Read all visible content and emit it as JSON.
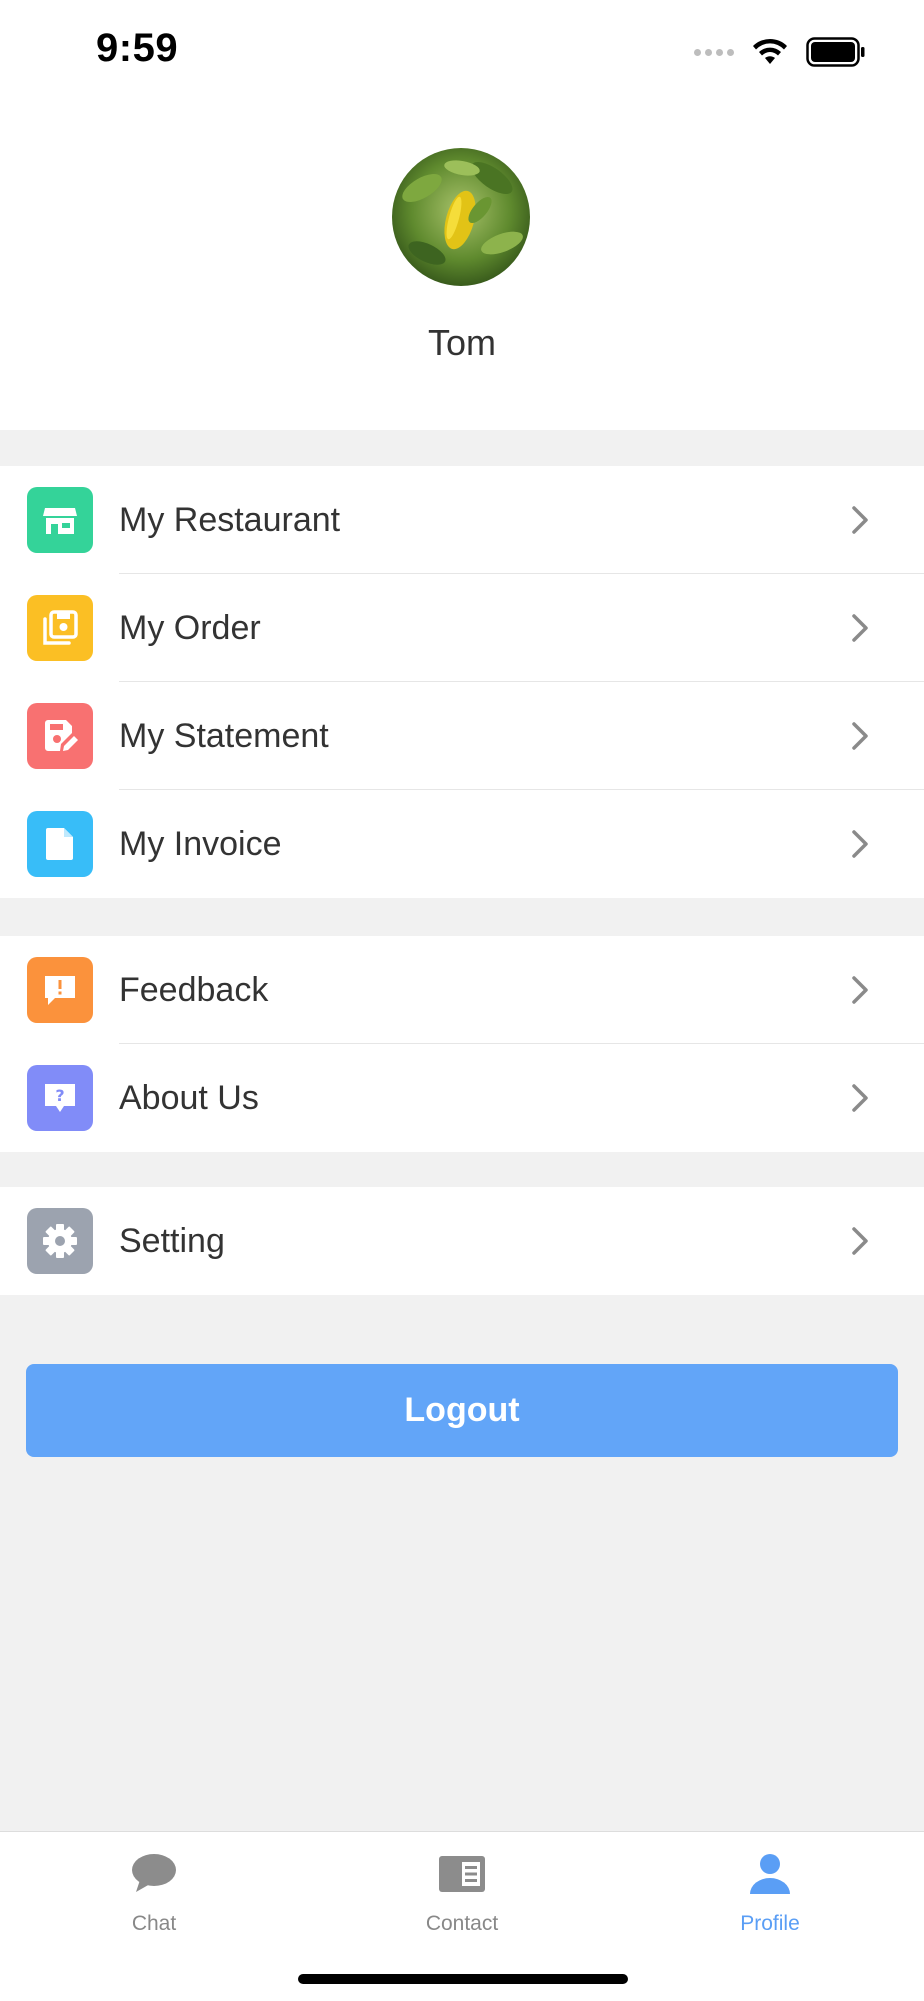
{
  "status_bar": {
    "time": "9:59"
  },
  "profile": {
    "name": "Tom"
  },
  "menu_groups": [
    {
      "items": [
        {
          "label": "My Restaurant",
          "icon": "store-icon",
          "color": "#34d399"
        },
        {
          "label": "My Order",
          "icon": "order-icon",
          "color": "#fbbf24"
        },
        {
          "label": "My Statement",
          "icon": "statement-edit-icon",
          "color": "#f87171"
        },
        {
          "label": "My Invoice",
          "icon": "invoice-document-icon",
          "color": "#38bdf8"
        }
      ]
    },
    {
      "items": [
        {
          "label": "Feedback",
          "icon": "feedback-icon",
          "color": "#fb923c"
        },
        {
          "label": "About Us",
          "icon": "help-question-icon",
          "color": "#818cf8"
        }
      ]
    },
    {
      "items": [
        {
          "label": "Setting",
          "icon": "gear-icon",
          "color": "#9ca3af"
        }
      ]
    }
  ],
  "logout": {
    "label": "Logout",
    "color": "#62a5f8"
  },
  "tab_bar": {
    "tabs": [
      {
        "label": "Chat",
        "icon": "chat-bubble-icon",
        "active": false
      },
      {
        "label": "Contact",
        "icon": "contact-card-icon",
        "active": false
      },
      {
        "label": "Profile",
        "icon": "person-icon",
        "active": true
      }
    ],
    "active_color": "#5a9ef5",
    "inactive_color": "#888888"
  }
}
